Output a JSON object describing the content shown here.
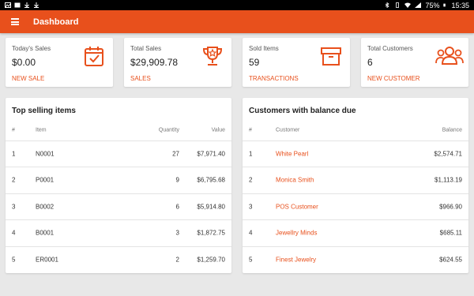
{
  "status_bar": {
    "battery": "75%",
    "time": "15:35"
  },
  "app_bar": {
    "title": "Dashboard"
  },
  "stats": [
    {
      "label": "Today's Sales",
      "value": "$0.00",
      "link": "NEW SALE",
      "icon": "calendar-check-icon"
    },
    {
      "label": "Total Sales",
      "value": "$29,909.78",
      "link": "SALES",
      "icon": "trophy-icon"
    },
    {
      "label": "Sold Items",
      "value": "59",
      "link": "TRANSACTIONS",
      "icon": "archive-box-icon"
    },
    {
      "label": "Total Customers",
      "value": "6",
      "link": "NEW CUSTOMER",
      "icon": "customers-group-icon"
    }
  ],
  "top_selling": {
    "title": "Top selling items",
    "headers": {
      "num": "#",
      "item": "Item",
      "quantity": "Quantity",
      "value": "Value"
    },
    "rows": [
      {
        "num": "1",
        "item": "N0001",
        "quantity": "27",
        "value": "$7,971.40"
      },
      {
        "num": "2",
        "item": "P0001",
        "quantity": "9",
        "value": "$6,795.68"
      },
      {
        "num": "3",
        "item": "B0002",
        "quantity": "6",
        "value": "$5,914.80"
      },
      {
        "num": "4",
        "item": "B0001",
        "quantity": "3",
        "value": "$1,872.75"
      },
      {
        "num": "5",
        "item": "ER0001",
        "quantity": "2",
        "value": "$1,259.70"
      }
    ]
  },
  "balance_due": {
    "title": "Customers with balance due",
    "headers": {
      "num": "#",
      "customer": "Customer",
      "balance": "Balance"
    },
    "rows": [
      {
        "num": "1",
        "customer": "White Pearl",
        "balance": "$2,574.71"
      },
      {
        "num": "2",
        "customer": "Monica Smith",
        "balance": "$1,113.19"
      },
      {
        "num": "3",
        "customer": "POS Customer",
        "balance": "$966.90"
      },
      {
        "num": "4",
        "customer": "Jewellry Minds",
        "balance": "$685.11"
      },
      {
        "num": "5",
        "customer": "Finest Jewelry",
        "balance": "$624.55"
      }
    ]
  },
  "colors": {
    "accent": "#e8501c",
    "background": "#e8e8e8"
  }
}
